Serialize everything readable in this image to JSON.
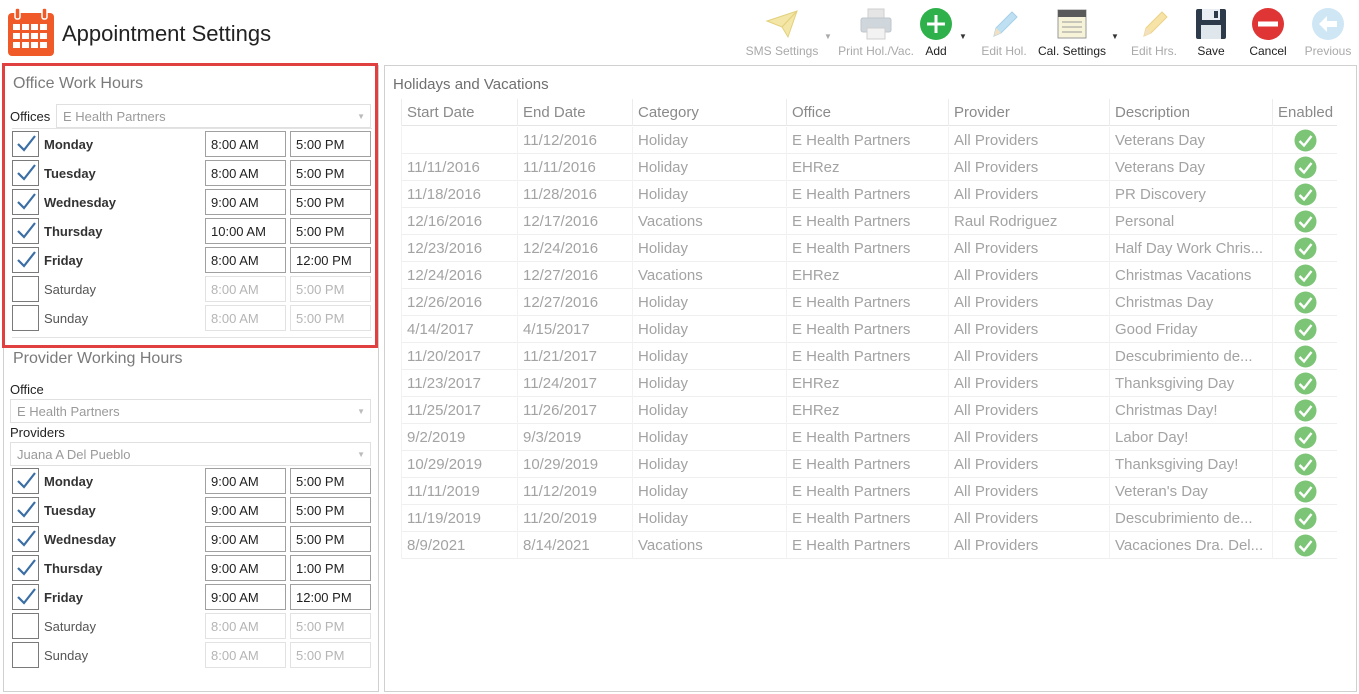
{
  "header": {
    "title": "Appointment Settings"
  },
  "toolbar": {
    "sms_settings": "SMS Settings",
    "print_hol_vac": "Print Hol./Vac.",
    "add": "Add",
    "edit_hol": "Edit Hol.",
    "cal_settings": "Cal. Settings",
    "edit_hrs": "Edit Hrs.",
    "save": "Save",
    "cancel": "Cancel",
    "previous": "Previous"
  },
  "office_hours": {
    "title": "Office Work Hours",
    "offices_label": "Offices",
    "office_value": "E Health Partners",
    "days": [
      {
        "name": "Monday",
        "checked": true,
        "start": "8:00 AM",
        "end": "5:00 PM"
      },
      {
        "name": "Tuesday",
        "checked": true,
        "start": "8:00 AM",
        "end": "5:00 PM"
      },
      {
        "name": "Wednesday",
        "checked": true,
        "start": "9:00 AM",
        "end": "5:00 PM"
      },
      {
        "name": "Thursday",
        "checked": true,
        "start": "10:00 AM",
        "end": "5:00 PM"
      },
      {
        "name": "Friday",
        "checked": true,
        "start": "8:00 AM",
        "end": "12:00 PM"
      },
      {
        "name": "Saturday",
        "checked": false,
        "start": "8:00 AM",
        "end": "5:00 PM"
      },
      {
        "name": "Sunday",
        "checked": false,
        "start": "8:00 AM",
        "end": "5:00 PM"
      }
    ]
  },
  "provider_hours": {
    "title": "Provider Working Hours",
    "office_label": "Office",
    "office_value": "E Health Partners",
    "providers_label": "Providers",
    "provider_value": "Juana A Del Pueblo",
    "days": [
      {
        "name": "Monday",
        "checked": true,
        "start": "9:00 AM",
        "end": "5:00 PM"
      },
      {
        "name": "Tuesday",
        "checked": true,
        "start": "9:00 AM",
        "end": "5:00 PM"
      },
      {
        "name": "Wednesday",
        "checked": true,
        "start": "9:00 AM",
        "end": "5:00 PM"
      },
      {
        "name": "Thursday",
        "checked": true,
        "start": "9:00 AM",
        "end": "1:00 PM"
      },
      {
        "name": "Friday",
        "checked": true,
        "start": "9:00 AM",
        "end": "12:00 PM"
      },
      {
        "name": "Saturday",
        "checked": false,
        "start": "8:00 AM",
        "end": "5:00 PM"
      },
      {
        "name": "Sunday",
        "checked": false,
        "start": "8:00 AM",
        "end": "5:00 PM"
      }
    ]
  },
  "holidays": {
    "title": "Holidays and Vacations",
    "columns": [
      "Start Date",
      "End Date",
      "Category",
      "Office",
      "Provider",
      "Description",
      "Enabled"
    ],
    "rows": [
      [
        "",
        "11/12/2016",
        "Holiday",
        "E Health Partners",
        "All Providers",
        "Veterans Day",
        true
      ],
      [
        "11/11/2016",
        "11/11/2016",
        "Holiday",
        "EHRez",
        "All Providers",
        "Veterans Day",
        true
      ],
      [
        "11/18/2016",
        "11/28/2016",
        "Holiday",
        "E Health Partners",
        "All Providers",
        "PR Discovery",
        true
      ],
      [
        "12/16/2016",
        "12/17/2016",
        "Vacations",
        "E Health Partners",
        "Raul Rodriguez",
        "Personal",
        true
      ],
      [
        "12/23/2016",
        "12/24/2016",
        "Holiday",
        "E Health Partners",
        "All Providers",
        "Half Day Work Chris...",
        true
      ],
      [
        "12/24/2016",
        "12/27/2016",
        "Vacations",
        "EHRez",
        "All Providers",
        "Christmas Vacations",
        true
      ],
      [
        "12/26/2016",
        "12/27/2016",
        "Holiday",
        "E Health Partners",
        "All Providers",
        "Christmas Day",
        true
      ],
      [
        "4/14/2017",
        "4/15/2017",
        "Holiday",
        "E Health Partners",
        "All Providers",
        "Good Friday",
        true
      ],
      [
        "11/20/2017",
        "11/21/2017",
        "Holiday",
        "E Health Partners",
        "All Providers",
        "Descubrimiento de...",
        true
      ],
      [
        "11/23/2017",
        "11/24/2017",
        "Holiday",
        "EHRez",
        "All Providers",
        "Thanksgiving Day",
        true
      ],
      [
        "11/25/2017",
        "11/26/2017",
        "Holiday",
        "EHRez",
        "All Providers",
        "Christmas Day!",
        true
      ],
      [
        "9/2/2019",
        "9/3/2019",
        "Holiday",
        "E Health Partners",
        "All Providers",
        "Labor Day!",
        true
      ],
      [
        "10/29/2019",
        "10/29/2019",
        "Holiday",
        "E Health Partners",
        "All Providers",
        "Thanksgiving Day!",
        true
      ],
      [
        "11/11/2019",
        "11/12/2019",
        "Holiday",
        "E Health Partners",
        "All Providers",
        "Veteran's Day",
        true
      ],
      [
        "11/19/2019",
        "11/20/2019",
        "Holiday",
        "E Health Partners",
        "All Providers",
        "Descubrimiento de...",
        true
      ],
      [
        "8/9/2021",
        "8/14/2021",
        "Vacations",
        "E Health Partners",
        "All Providers",
        "Vacaciones Dra. Del...",
        true
      ]
    ]
  },
  "colors": {
    "accent_red": "#e04040",
    "calendar_orange": "#f05a28",
    "enabled_green": "#7cc576",
    "add_green": "#2eb14b",
    "cancel_red": "#e03535"
  }
}
